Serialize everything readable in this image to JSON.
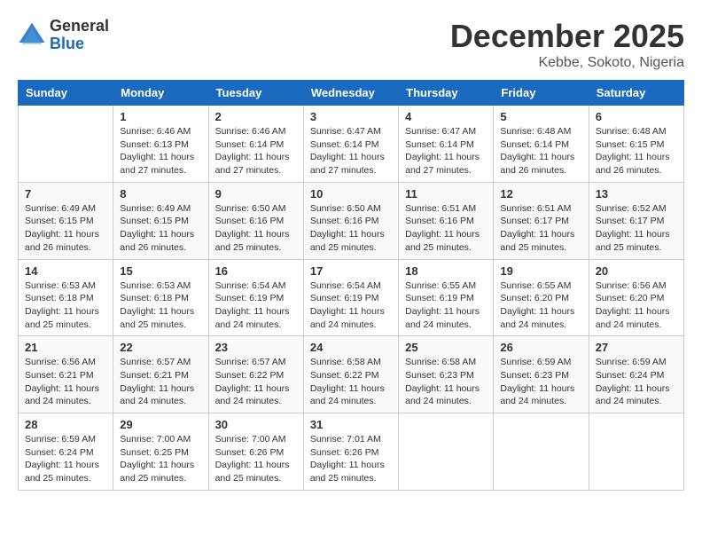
{
  "logo": {
    "general": "General",
    "blue": "Blue"
  },
  "header": {
    "month": "December 2025",
    "location": "Kebbe, Sokoto, Nigeria"
  },
  "weekdays": [
    "Sunday",
    "Monday",
    "Tuesday",
    "Wednesday",
    "Thursday",
    "Friday",
    "Saturday"
  ],
  "weeks": [
    [
      {
        "day": "",
        "sunrise": "",
        "sunset": "",
        "daylight": ""
      },
      {
        "day": "1",
        "sunrise": "Sunrise: 6:46 AM",
        "sunset": "Sunset: 6:13 PM",
        "daylight": "Daylight: 11 hours and 27 minutes."
      },
      {
        "day": "2",
        "sunrise": "Sunrise: 6:46 AM",
        "sunset": "Sunset: 6:14 PM",
        "daylight": "Daylight: 11 hours and 27 minutes."
      },
      {
        "day": "3",
        "sunrise": "Sunrise: 6:47 AM",
        "sunset": "Sunset: 6:14 PM",
        "daylight": "Daylight: 11 hours and 27 minutes."
      },
      {
        "day": "4",
        "sunrise": "Sunrise: 6:47 AM",
        "sunset": "Sunset: 6:14 PM",
        "daylight": "Daylight: 11 hours and 27 minutes."
      },
      {
        "day": "5",
        "sunrise": "Sunrise: 6:48 AM",
        "sunset": "Sunset: 6:14 PM",
        "daylight": "Daylight: 11 hours and 26 minutes."
      },
      {
        "day": "6",
        "sunrise": "Sunrise: 6:48 AM",
        "sunset": "Sunset: 6:15 PM",
        "daylight": "Daylight: 11 hours and 26 minutes."
      }
    ],
    [
      {
        "day": "7",
        "sunrise": "Sunrise: 6:49 AM",
        "sunset": "Sunset: 6:15 PM",
        "daylight": "Daylight: 11 hours and 26 minutes."
      },
      {
        "day": "8",
        "sunrise": "Sunrise: 6:49 AM",
        "sunset": "Sunset: 6:15 PM",
        "daylight": "Daylight: 11 hours and 26 minutes."
      },
      {
        "day": "9",
        "sunrise": "Sunrise: 6:50 AM",
        "sunset": "Sunset: 6:16 PM",
        "daylight": "Daylight: 11 hours and 25 minutes."
      },
      {
        "day": "10",
        "sunrise": "Sunrise: 6:50 AM",
        "sunset": "Sunset: 6:16 PM",
        "daylight": "Daylight: 11 hours and 25 minutes."
      },
      {
        "day": "11",
        "sunrise": "Sunrise: 6:51 AM",
        "sunset": "Sunset: 6:16 PM",
        "daylight": "Daylight: 11 hours and 25 minutes."
      },
      {
        "day": "12",
        "sunrise": "Sunrise: 6:51 AM",
        "sunset": "Sunset: 6:17 PM",
        "daylight": "Daylight: 11 hours and 25 minutes."
      },
      {
        "day": "13",
        "sunrise": "Sunrise: 6:52 AM",
        "sunset": "Sunset: 6:17 PM",
        "daylight": "Daylight: 11 hours and 25 minutes."
      }
    ],
    [
      {
        "day": "14",
        "sunrise": "Sunrise: 6:53 AM",
        "sunset": "Sunset: 6:18 PM",
        "daylight": "Daylight: 11 hours and 25 minutes."
      },
      {
        "day": "15",
        "sunrise": "Sunrise: 6:53 AM",
        "sunset": "Sunset: 6:18 PM",
        "daylight": "Daylight: 11 hours and 25 minutes."
      },
      {
        "day": "16",
        "sunrise": "Sunrise: 6:54 AM",
        "sunset": "Sunset: 6:19 PM",
        "daylight": "Daylight: 11 hours and 24 minutes."
      },
      {
        "day": "17",
        "sunrise": "Sunrise: 6:54 AM",
        "sunset": "Sunset: 6:19 PM",
        "daylight": "Daylight: 11 hours and 24 minutes."
      },
      {
        "day": "18",
        "sunrise": "Sunrise: 6:55 AM",
        "sunset": "Sunset: 6:19 PM",
        "daylight": "Daylight: 11 hours and 24 minutes."
      },
      {
        "day": "19",
        "sunrise": "Sunrise: 6:55 AM",
        "sunset": "Sunset: 6:20 PM",
        "daylight": "Daylight: 11 hours and 24 minutes."
      },
      {
        "day": "20",
        "sunrise": "Sunrise: 6:56 AM",
        "sunset": "Sunset: 6:20 PM",
        "daylight": "Daylight: 11 hours and 24 minutes."
      }
    ],
    [
      {
        "day": "21",
        "sunrise": "Sunrise: 6:56 AM",
        "sunset": "Sunset: 6:21 PM",
        "daylight": "Daylight: 11 hours and 24 minutes."
      },
      {
        "day": "22",
        "sunrise": "Sunrise: 6:57 AM",
        "sunset": "Sunset: 6:21 PM",
        "daylight": "Daylight: 11 hours and 24 minutes."
      },
      {
        "day": "23",
        "sunrise": "Sunrise: 6:57 AM",
        "sunset": "Sunset: 6:22 PM",
        "daylight": "Daylight: 11 hours and 24 minutes."
      },
      {
        "day": "24",
        "sunrise": "Sunrise: 6:58 AM",
        "sunset": "Sunset: 6:22 PM",
        "daylight": "Daylight: 11 hours and 24 minutes."
      },
      {
        "day": "25",
        "sunrise": "Sunrise: 6:58 AM",
        "sunset": "Sunset: 6:23 PM",
        "daylight": "Daylight: 11 hours and 24 minutes."
      },
      {
        "day": "26",
        "sunrise": "Sunrise: 6:59 AM",
        "sunset": "Sunset: 6:23 PM",
        "daylight": "Daylight: 11 hours and 24 minutes."
      },
      {
        "day": "27",
        "sunrise": "Sunrise: 6:59 AM",
        "sunset": "Sunset: 6:24 PM",
        "daylight": "Daylight: 11 hours and 24 minutes."
      }
    ],
    [
      {
        "day": "28",
        "sunrise": "Sunrise: 6:59 AM",
        "sunset": "Sunset: 6:24 PM",
        "daylight": "Daylight: 11 hours and 25 minutes."
      },
      {
        "day": "29",
        "sunrise": "Sunrise: 7:00 AM",
        "sunset": "Sunset: 6:25 PM",
        "daylight": "Daylight: 11 hours and 25 minutes."
      },
      {
        "day": "30",
        "sunrise": "Sunrise: 7:00 AM",
        "sunset": "Sunset: 6:26 PM",
        "daylight": "Daylight: 11 hours and 25 minutes."
      },
      {
        "day": "31",
        "sunrise": "Sunrise: 7:01 AM",
        "sunset": "Sunset: 6:26 PM",
        "daylight": "Daylight: 11 hours and 25 minutes."
      },
      {
        "day": "",
        "sunrise": "",
        "sunset": "",
        "daylight": ""
      },
      {
        "day": "",
        "sunrise": "",
        "sunset": "",
        "daylight": ""
      },
      {
        "day": "",
        "sunrise": "",
        "sunset": "",
        "daylight": ""
      }
    ]
  ]
}
